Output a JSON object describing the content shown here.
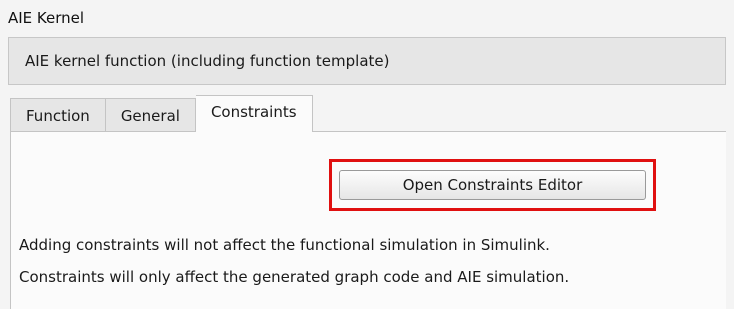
{
  "dialog": {
    "title": "AIE Kernel",
    "description": "AIE kernel function (including function template)"
  },
  "tabs": [
    {
      "label": "Function",
      "active": false
    },
    {
      "label": "General",
      "active": false
    },
    {
      "label": "Constraints",
      "active": true
    }
  ],
  "constraints_panel": {
    "open_editor_label": "Open Constraints Editor",
    "info_lines": [
      "Adding constraints will not affect the functional simulation in Simulink.",
      "Constraints will only affect the generated graph code and AIE simulation."
    ]
  },
  "colors": {
    "highlight": "#e01010",
    "background": "#f4f4f4",
    "panel": "#fbfbfb"
  }
}
